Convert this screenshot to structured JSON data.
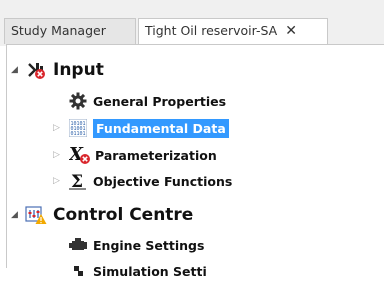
{
  "tabs": [
    {
      "label": "Study Manager",
      "active": false
    },
    {
      "label": "Tight Oil reservoir-SA",
      "active": true,
      "close": "✕"
    }
  ],
  "tree": {
    "input": {
      "label": "Input",
      "icon": "input-error-icon",
      "children": [
        {
          "label": "General Properties",
          "icon": "gear-icon"
        },
        {
          "label": "Fundamental Data",
          "icon": "binary-data-icon",
          "selected": true
        },
        {
          "label": "Parameterization",
          "icon": "x-parameter-error-icon"
        },
        {
          "label": "Objective Functions",
          "icon": "sigma-icon"
        }
      ]
    },
    "control": {
      "label": "Control Centre",
      "icon": "control-warning-icon",
      "children": [
        {
          "label": "Engine Settings",
          "icon": "engine-icon"
        },
        {
          "label": "Simulation Setti",
          "icon": "simulation-icon"
        }
      ]
    }
  },
  "colors": {
    "selection": "#3399ff",
    "error": "#d9262c",
    "warning": "#f2a900"
  }
}
